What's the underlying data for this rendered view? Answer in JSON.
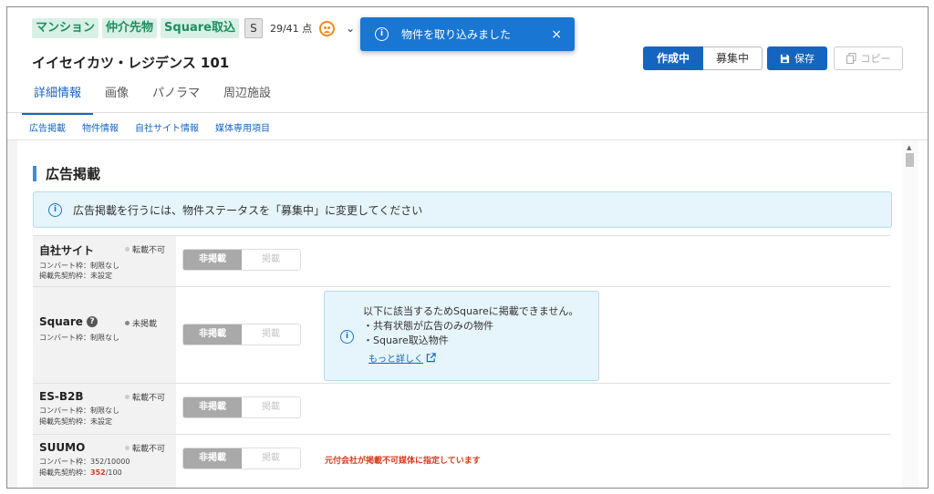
{
  "header": {
    "tags": [
      "マンション",
      "仲介先物",
      "Square取込"
    ],
    "grade": "S",
    "score": "29/41 点",
    "title": "イイセイカツ・レジデンス 101",
    "status_active": "作成中",
    "status_inactive": "募集中",
    "save_label": "保存",
    "copy_label": "コピー"
  },
  "toast": {
    "message": "物件を取り込みました",
    "close": "×"
  },
  "tabs": [
    "詳細情報",
    "画像",
    "パノラマ",
    "周辺施設"
  ],
  "subnav": [
    "広告掲載",
    "物件情報",
    "自社サイト情報",
    "媒体専用項目"
  ],
  "section": {
    "title": "広告掲載",
    "info": "広告掲載を行うには、物件ステータスを「募集中」に変更してください"
  },
  "toggle": {
    "on_label": "非掲載",
    "off_label": "掲載"
  },
  "rows": [
    {
      "name": "自社サイト",
      "state": "転載不可",
      "sub1": "コンバート枠：制限なし",
      "sub2": "掲載先契約枠：未設定"
    },
    {
      "name": "Square",
      "state": "未掲載",
      "sub1": "コンバート枠：制限なし"
    },
    {
      "name": "ES-B2B",
      "state": "転載不可",
      "sub1": "コンバート枠：制限なし",
      "sub2": "掲載先契約枠：未設定"
    },
    {
      "name": "SUUMO",
      "state": "転載不可",
      "sub1": "コンバート枠：352/10000",
      "sub2_prefix": "掲載先契約枠：",
      "sub2_red": "352",
      "sub2_suffix": "/100"
    }
  ],
  "square_notice": {
    "line1": "以下に該当するためSquareに掲載できません。",
    "line2": "・共有状態が広告のみの物件",
    "line3": "・Square取込物件",
    "more": "もっと詳しく"
  },
  "suumo_warning": "元付会社が掲載不可媒体に指定しています"
}
